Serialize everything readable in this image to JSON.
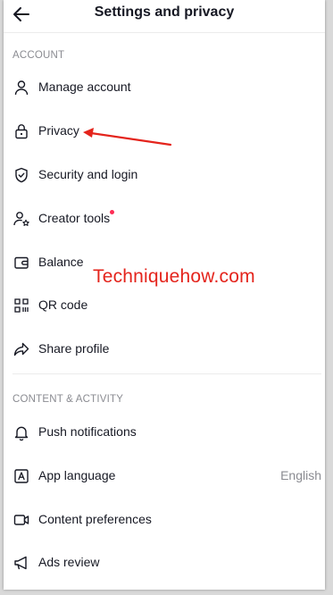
{
  "header": {
    "title": "Settings and privacy",
    "back_icon": "arrow-left-icon"
  },
  "account": {
    "heading": "ACCOUNT",
    "items": [
      {
        "label": "Manage account",
        "icon": "person-icon"
      },
      {
        "label": "Privacy",
        "icon": "lock-icon"
      },
      {
        "label": "Security and login",
        "icon": "shield-icon"
      },
      {
        "label": "Creator tools",
        "icon": "creator-icon",
        "badge": "red-dot"
      },
      {
        "label": "Balance",
        "icon": "wallet-icon"
      },
      {
        "label": "QR code",
        "icon": "qr-code-icon"
      },
      {
        "label": "Share profile",
        "icon": "share-icon"
      }
    ]
  },
  "content_activity": {
    "heading": "CONTENT & ACTIVITY",
    "items": [
      {
        "label": "Push notifications",
        "icon": "bell-icon"
      },
      {
        "label": "App language",
        "icon": "language-icon",
        "value": "English"
      },
      {
        "label": "Content preferences",
        "icon": "video-icon"
      },
      {
        "label": "Ads review",
        "icon": "megaphone-icon"
      }
    ]
  },
  "watermark": {
    "text": "Techniquehow.com"
  },
  "colors": {
    "accent_red": "#e4241c",
    "badge_red": "#fe2c55",
    "text": "#161823",
    "muted": "#8a8b91"
  }
}
